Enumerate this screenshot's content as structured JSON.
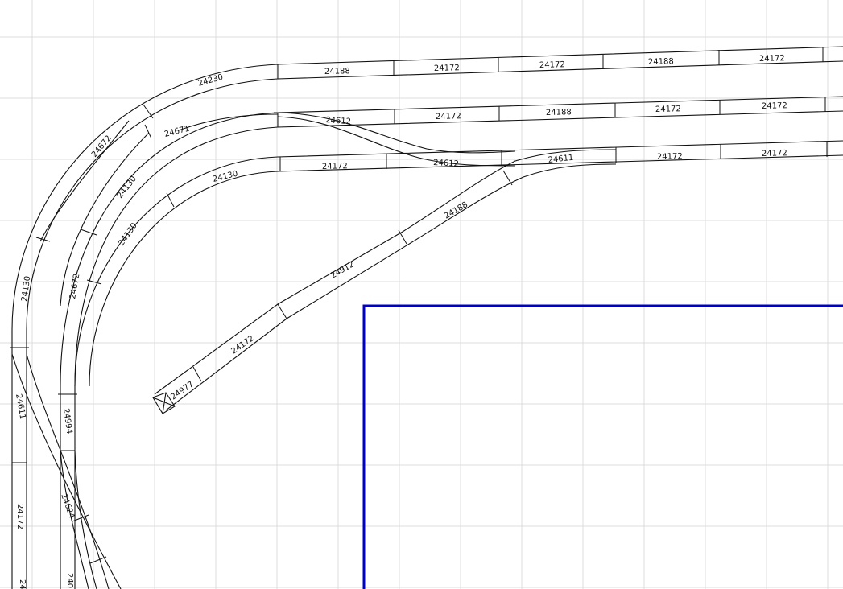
{
  "colors": {
    "background": "#ffffff",
    "grid": "#dcdcdc",
    "track": "#111111",
    "baseboard_outline": "#0000cc"
  },
  "track_labels": {
    "t1_a": "24230",
    "t1_b": "24188",
    "t1_c": "24172",
    "t1_d": "24172",
    "t1_e": "24188",
    "t1_f": "24172",
    "t2_a": "24671",
    "t2_b": "24612",
    "t2_c": "24172",
    "t2_d": "24188",
    "t2_e": "24172",
    "t2_f": "24172",
    "t3_a": "24130",
    "t3_b": "24172",
    "t3_c": "24612",
    "t3_d": "24611",
    "t3_e": "24172",
    "t3_f": "24172",
    "c_a": "24672",
    "c_b": "24130",
    "c_c": "24130",
    "c_d": "24130",
    "c_e": "24672",
    "s_a": "24188",
    "s_b": "24912",
    "s_c": "24172",
    "s_d": "24977",
    "v_a": "24611",
    "v_b": "24172",
    "v_c": "24994",
    "v_d": "24624",
    "v_e": "24",
    "v_f": "240"
  }
}
